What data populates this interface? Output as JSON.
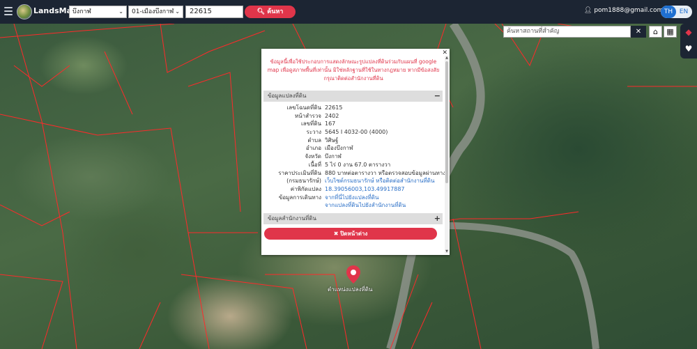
{
  "header": {
    "app_title": "LandsMaps",
    "province_select": "บึงกาฬ",
    "district_select": "01-เมืองบึงกาฬ",
    "parcel_input": "22615",
    "search_label": "ค้นหา",
    "user_email": "pom1888@gmail.com",
    "lang_th": "TH",
    "lang_en": "EN"
  },
  "map": {
    "search_placeholder": "ค้นหาสถานที่สำคัญ",
    "pin_label": "ตำแหน่งแปลงที่ดิน"
  },
  "popup": {
    "notice": "ข้อมูลนี้เพื่อใช้ประกอบการแสดงลักษณะรูปแปลงที่ดินร่วมกับแผนที่ google map เพื่อดูสภาพพื้นที่เท่านั้น มิใช่หลักฐานที่ใช้ในทางกฎหมาย หากมีข้อสงสัยกรุณาติดต่อสำนักงานที่ดิน",
    "section1_title": "ข้อมูลแปลงที่ดิน",
    "section2_title": "ข้อมูลสำนักงานที่ดิน",
    "rows": [
      {
        "k": "เลขโฉนดที่ดิน",
        "v": "22615"
      },
      {
        "k": "หน้าสำรวจ",
        "v": "2402"
      },
      {
        "k": "เลขที่ดิน",
        "v": "167"
      },
      {
        "k": "ระวาง",
        "v": "5645 I 4032-00 (4000)"
      },
      {
        "k": "ตำบล",
        "v": "วิศิษฐ์"
      },
      {
        "k": "อำเภอ",
        "v": "เมืองบึงกาฬ"
      },
      {
        "k": "จังหวัด",
        "v": "บึงกาฬ"
      },
      {
        "k": "เนื้อที่",
        "v": "5 ไร่ 0 งาน 67.0 ตารางวา"
      },
      {
        "k": "ราคาประเมินที่ดิน",
        "v": "880 บาทต่อตารางวา หรือตรวจสอบข้อมูลผ่านทาง"
      },
      {
        "k": "(กรมธนารักษ์)",
        "v": "เว็บไซต์กรมธนารักษ์ หรือติดต่อสำนักงานที่ดิน"
      },
      {
        "k": "ค่าพิกัดแปลง",
        "v": "18.39056003,103.49917887"
      },
      {
        "k": "ข้อมูลการเดินทาง",
        "v": "จากที่นี่ไปยังแปลงที่ดิน"
      },
      {
        "k": "",
        "v": "จากแปลงที่ดินไปยังสำนักงานที่ดิน"
      }
    ],
    "close_label": "✖ ปิดหน้าต่าง"
  },
  "colors": {
    "header_bg": "#1c2533",
    "accent_red": "#e0354a",
    "link_blue": "#2a6fc7",
    "parcel_line": "#ff2a2a"
  },
  "icons": [
    "menu-icon",
    "logo-icon",
    "search-icon",
    "user-icon",
    "close-icon",
    "home-icon",
    "grid-icon",
    "layers-icon",
    "heart-icon",
    "map-pin-icon"
  ]
}
